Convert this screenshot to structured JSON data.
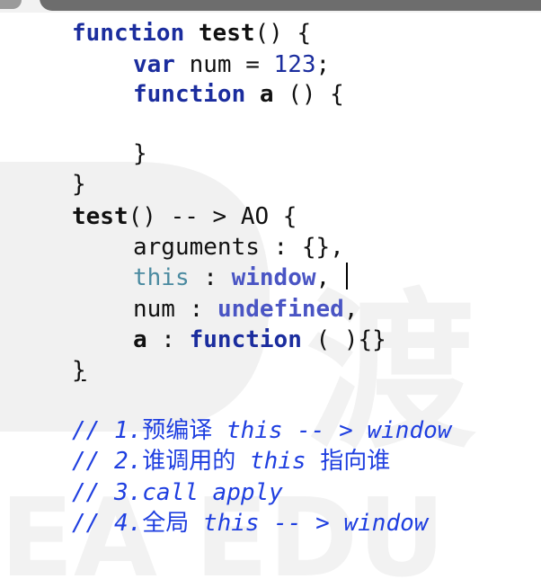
{
  "code": {
    "l1": {
      "kw": "function",
      "name": "test",
      "rest": "() {"
    },
    "l2": {
      "kw": "var",
      "rest": "num = ",
      "num": "123",
      "end": ";"
    },
    "l3": {
      "kw": "function",
      "name": "a",
      "rest": "() {"
    },
    "l5": {
      "text": "}"
    },
    "l6": {
      "text": "}"
    },
    "l7": {
      "name": "test",
      "rest": "() -- > AO {"
    },
    "l8": {
      "key": "arguments",
      "rest": " : {},"
    },
    "l9": {
      "key": "this",
      "sep": " : ",
      "val": "window",
      "end": ","
    },
    "l10": {
      "key": "num",
      "sep": " : ",
      "val": "undefined",
      "end": ","
    },
    "l11": {
      "key": "a",
      "sep": " : ",
      "val": "function",
      "end": " ( ){}"
    },
    "l12": {
      "text": "}"
    }
  },
  "comments": [
    {
      "prefix": "// 1.",
      "cjk": "预编译",
      "rest": " this -- > window"
    },
    {
      "prefix": "// 2.",
      "cjk": "谁调用的",
      "rest": " this ",
      "cjk2": "指向谁"
    },
    {
      "prefix": "// 3.",
      "rest": "call apply"
    },
    {
      "prefix": "// 4.",
      "cjk": "全局",
      "rest": " this -- > window"
    }
  ],
  "colors": {
    "keyword": "#1b2d9e",
    "comment": "#1f3fe0",
    "this_key": "#4a8aa0",
    "value": "#4a55c4"
  }
}
